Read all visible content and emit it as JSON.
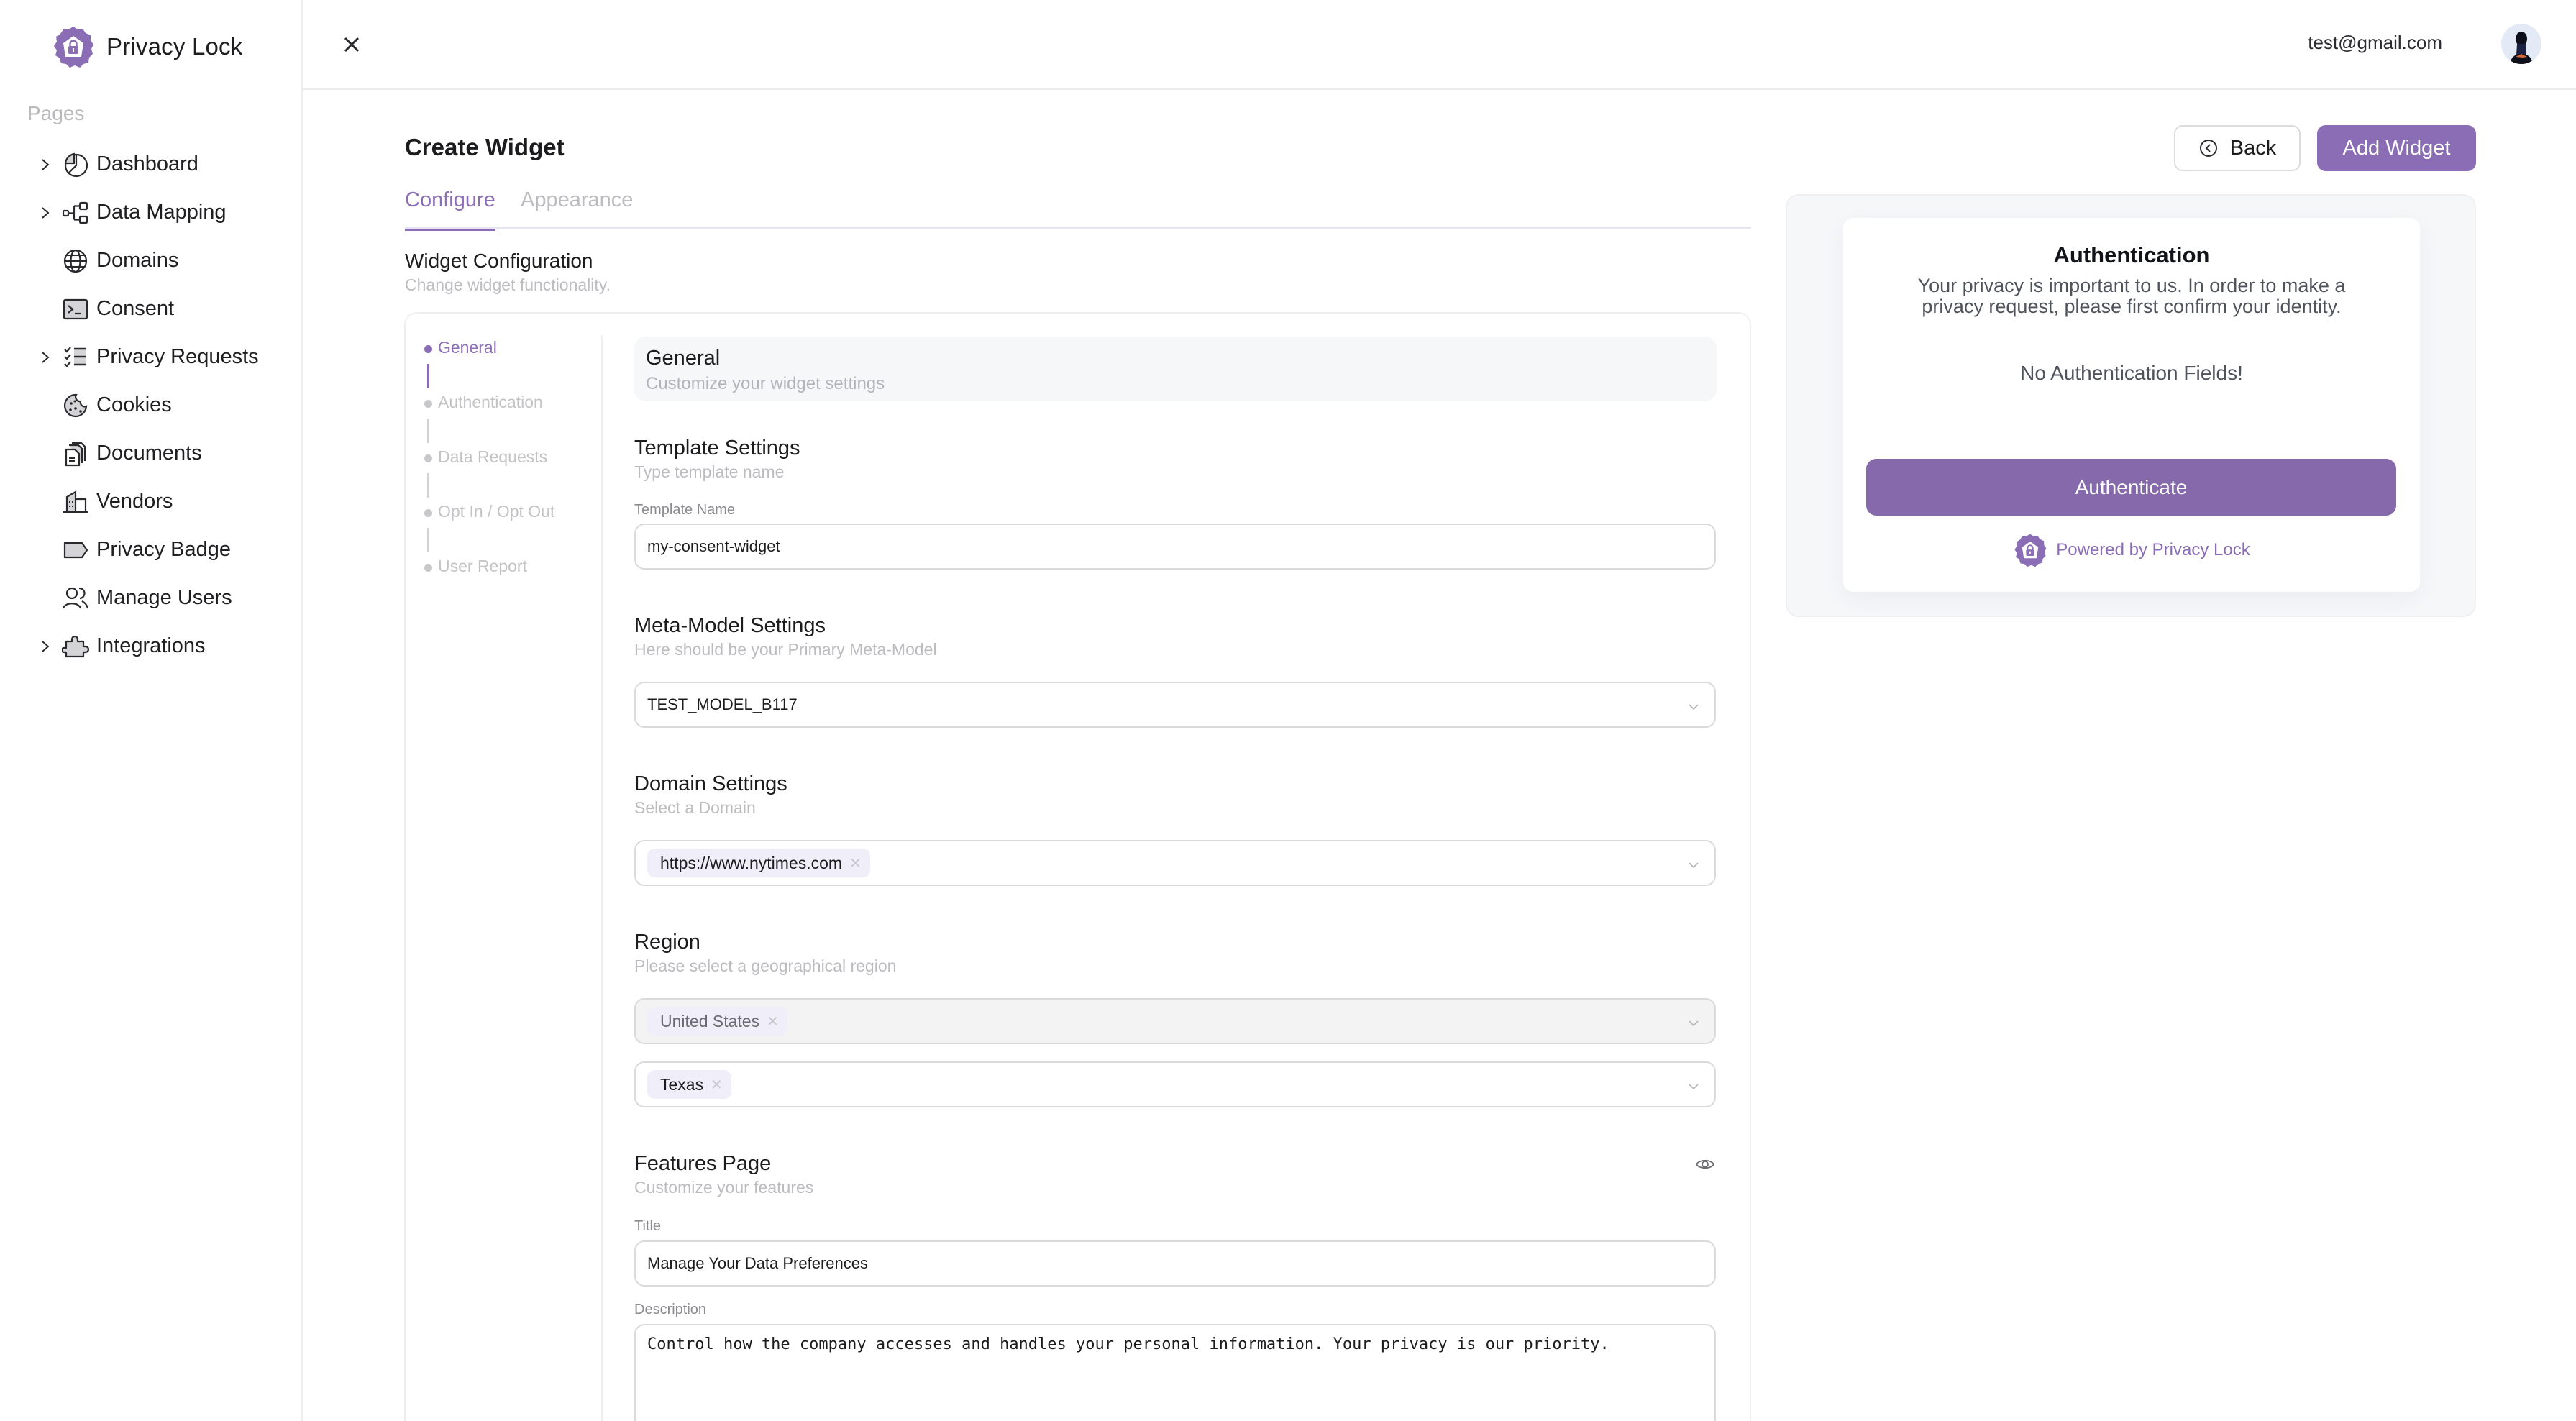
{
  "brand": {
    "name": "Privacy Lock",
    "logo_icon": "privacy-lock-badge-icon",
    "accent_color": "#8a6db5"
  },
  "sidebar": {
    "section_label": "Pages",
    "items": [
      {
        "label": "Dashboard",
        "icon": "pie-chart-icon",
        "expandable": true
      },
      {
        "label": "Data Mapping",
        "icon": "flow-diagram-icon",
        "expandable": true
      },
      {
        "label": "Domains",
        "icon": "globe-icon",
        "expandable": false
      },
      {
        "label": "Consent",
        "icon": "terminal-icon",
        "expandable": false
      },
      {
        "label": "Privacy Requests",
        "icon": "checklist-icon",
        "expandable": true
      },
      {
        "label": "Cookies",
        "icon": "cookie-icon",
        "expandable": false
      },
      {
        "label": "Documents",
        "icon": "documents-icon",
        "expandable": false
      },
      {
        "label": "Vendors",
        "icon": "building-icon",
        "expandable": false
      },
      {
        "label": "Privacy Badge",
        "icon": "tag-icon",
        "expandable": false
      },
      {
        "label": "Manage Users",
        "icon": "users-icon",
        "expandable": false
      },
      {
        "label": "Integrations",
        "icon": "puzzle-icon",
        "expandable": true
      }
    ]
  },
  "header": {
    "close_icon": "close-icon",
    "user_email": "test@gmail.com",
    "avatar_icon": "user-avatar"
  },
  "page": {
    "title": "Create Widget",
    "back_label": "Back",
    "add_label": "Add Widget",
    "tabs": [
      {
        "label": "Configure",
        "active": true
      },
      {
        "label": "Appearance",
        "active": false
      }
    ],
    "section_title": "Widget Configuration",
    "section_subtitle": "Change widget functionality."
  },
  "stepper": {
    "steps": [
      {
        "label": "General",
        "active": true
      },
      {
        "label": "Authentication",
        "active": false
      },
      {
        "label": "Data Requests",
        "active": false
      },
      {
        "label": "Opt In / Opt Out",
        "active": false
      },
      {
        "label": "User Report",
        "active": false
      }
    ]
  },
  "form": {
    "general": {
      "title": "General",
      "subtitle": "Customize your widget settings"
    },
    "template": {
      "title": "Template Settings",
      "subtitle": "Type template name",
      "field_label": "Template Name",
      "value": "my-consent-widget"
    },
    "meta_model": {
      "title": "Meta-Model Settings",
      "subtitle": "Here should be your Primary Meta-Model",
      "value": "TEST_MODEL_B117"
    },
    "domain": {
      "title": "Domain Settings",
      "subtitle": "Select a Domain",
      "selected": [
        "https://www.nytimes.com"
      ]
    },
    "region": {
      "title": "Region",
      "subtitle": "Please select a geographical region",
      "country_selected": [
        "United States"
      ],
      "country_disabled": true,
      "state_selected": [
        "Texas"
      ]
    },
    "features": {
      "title": "Features Page",
      "subtitle": "Customize your features",
      "visibility_icon": "eye-icon",
      "title_label": "Title",
      "title_value": "Manage Your Data Preferences",
      "description_label": "Description",
      "description_value": "Control how the company accesses and handles your personal information. Your privacy is our priority."
    }
  },
  "preview": {
    "title": "Authentication",
    "text": "Your privacy is important to us. In order to make a privacy request, please first confirm your identity.",
    "empty_message": "No Authentication Fields!",
    "button_label": "Authenticate",
    "powered_by": "Powered by Privacy Lock"
  }
}
